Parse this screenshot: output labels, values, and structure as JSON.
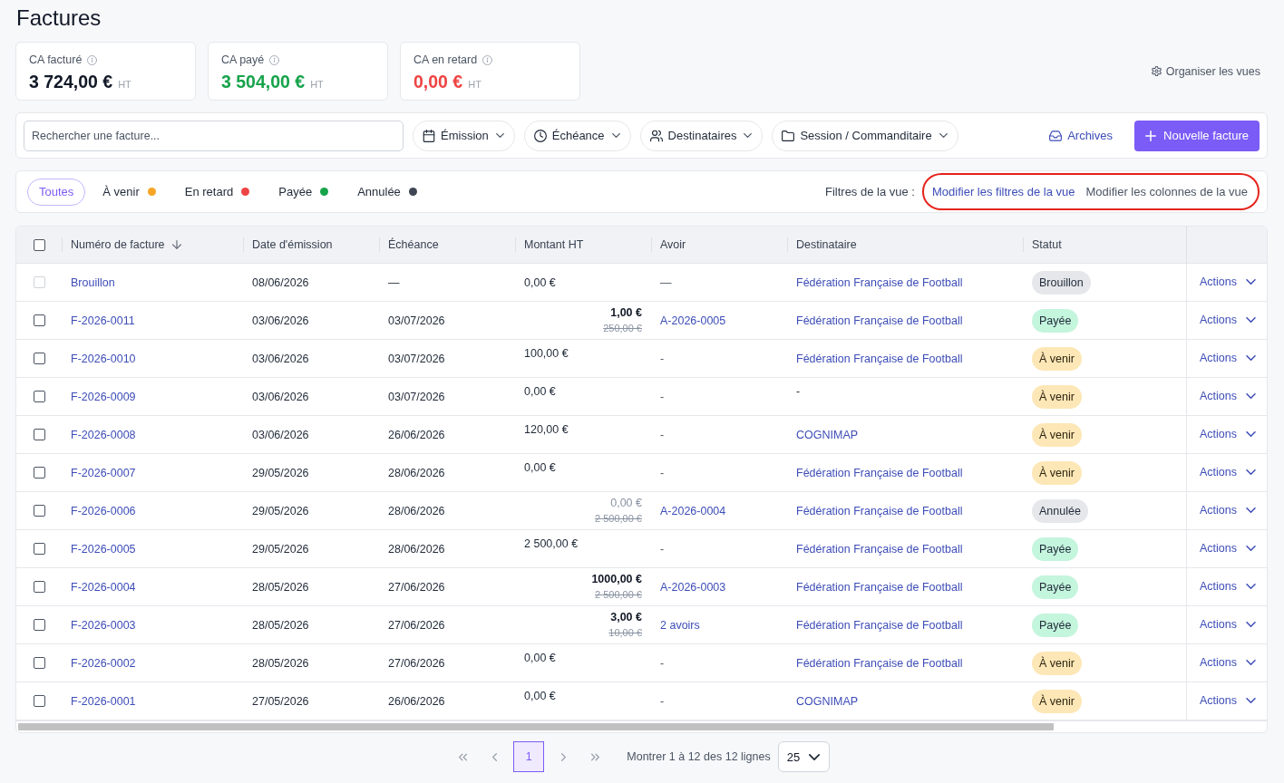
{
  "page": {
    "title": "Factures"
  },
  "kpis": [
    {
      "label": "CA facturé",
      "value": "3 724,00 €",
      "unit": "HT",
      "color": "#111827"
    },
    {
      "label": "CA payé",
      "value": "3 504,00 €",
      "unit": "HT",
      "color": "#16a34a"
    },
    {
      "label": "CA en retard",
      "value": "0,00 €",
      "unit": "HT",
      "color": "#ef4444"
    }
  ],
  "organize_views": {
    "label": "Organiser les vues"
  },
  "toolbar": {
    "search": {
      "placeholder": "Rechercher une facture..."
    },
    "filters": [
      {
        "label": "Émission",
        "kind": "calendar"
      },
      {
        "label": "Échéance",
        "kind": "clock"
      },
      {
        "label": "Destinataires",
        "kind": "people"
      },
      {
        "label": "Session / Commanditaire",
        "kind": "folder"
      }
    ],
    "archives": {
      "label": "Archives"
    },
    "new_button": {
      "label": "Nouvelle facture"
    }
  },
  "status_tabs": [
    {
      "label": "Toutes",
      "selected": true
    },
    {
      "label": "À venir",
      "selected": false,
      "color": "#f5a524"
    },
    {
      "label": "En retard",
      "selected": false,
      "color": "#ef4444"
    },
    {
      "label": "Payée",
      "selected": false,
      "color": "#16a34a"
    },
    {
      "label": "Annulée",
      "selected": false,
      "color": "#3f4654"
    }
  ],
  "view_filters": {
    "label": "Filtres de la vue :",
    "circled": true,
    "links": [
      {
        "label": "Modifier les filtres de la vue",
        "kind": "primary"
      },
      {
        "label": "Modifier les colonnes de la vue",
        "kind": "secondary"
      }
    ]
  },
  "table": {
    "select_all": {
      "checked": false
    },
    "columns": [
      {
        "label": "Numéro de facture",
        "sorted": true
      },
      {
        "label": "Date d'émission",
        "sorted": false
      },
      {
        "label": "Échéance",
        "sorted": false
      },
      {
        "label": "Montant HT",
        "sorted": false
      },
      {
        "label": "Avoir",
        "sorted": false
      },
      {
        "label": "Destinataire",
        "sorted": false
      },
      {
        "label": "Statut",
        "sorted": false
      }
    ],
    "rows": [
      {
        "checkbox": {
          "checked": false,
          "disabled": true
        },
        "number": "Brouillon",
        "issue_date": "08/06/2026",
        "due_date": "—",
        "amount": {
          "kind": "draft",
          "value": "0,00 €"
        },
        "credit_note": {
          "text": "—",
          "link": false
        },
        "recipient": {
          "text": "Fédération Française de Football",
          "link": true
        },
        "status": {
          "label": "Brouillon",
          "kind": "draft"
        },
        "actions": "Actions"
      },
      {
        "checkbox": {
          "checked": false,
          "disabled": false
        },
        "number": "F-2026-0011",
        "issue_date": "03/06/2026",
        "due_date": "03/07/2026",
        "amount": {
          "kind": "credited",
          "value": "1,00 €",
          "original": "250,00 €"
        },
        "credit_note": {
          "text": "A-2026-0005",
          "link": true
        },
        "recipient": {
          "text": "Fédération Française de Football",
          "link": true
        },
        "status": {
          "label": "Payée",
          "kind": "paid"
        },
        "actions": "Actions"
      },
      {
        "checkbox": {
          "checked": false,
          "disabled": false
        },
        "number": "F-2026-0010",
        "issue_date": "03/06/2026",
        "due_date": "03/07/2026",
        "amount": {
          "kind": "plain",
          "value": "100,00 €"
        },
        "credit_note": {
          "text": "-",
          "link": false
        },
        "recipient": {
          "text": "Fédération Française de Football",
          "link": true
        },
        "status": {
          "label": "À venir",
          "kind": "upcoming"
        },
        "actions": "Actions"
      },
      {
        "checkbox": {
          "checked": false,
          "disabled": false
        },
        "number": "F-2026-0009",
        "issue_date": "03/06/2026",
        "due_date": "03/07/2026",
        "amount": {
          "kind": "plain",
          "value": "0,00 €"
        },
        "credit_note": {
          "text": "-",
          "link": false
        },
        "recipient": {
          "text": "-",
          "link": false
        },
        "status": {
          "label": "À venir",
          "kind": "upcoming"
        },
        "actions": "Actions"
      },
      {
        "checkbox": {
          "checked": false,
          "disabled": false
        },
        "number": "F-2026-0008",
        "issue_date": "03/06/2026",
        "due_date": "26/06/2026",
        "amount": {
          "kind": "plain",
          "value": "120,00 €"
        },
        "credit_note": {
          "text": "-",
          "link": false
        },
        "recipient": {
          "text": "COGNIMAP",
          "link": true
        },
        "status": {
          "label": "À venir",
          "kind": "upcoming"
        },
        "actions": "Actions"
      },
      {
        "checkbox": {
          "checked": false,
          "disabled": false
        },
        "number": "F-2026-0007",
        "issue_date": "29/05/2026",
        "due_date": "28/06/2026",
        "amount": {
          "kind": "plain",
          "value": "0,00 €"
        },
        "credit_note": {
          "text": "-",
          "link": false
        },
        "recipient": {
          "text": "Fédération Française de Football",
          "link": true
        },
        "status": {
          "label": "À venir",
          "kind": "upcoming"
        },
        "actions": "Actions"
      },
      {
        "checkbox": {
          "checked": false,
          "disabled": false
        },
        "number": "F-2026-0006",
        "issue_date": "29/05/2026",
        "due_date": "28/06/2026",
        "amount": {
          "kind": "cancelled",
          "value": "0,00 €",
          "original": "2 500,00 €"
        },
        "credit_note": {
          "text": "A-2026-0004",
          "link": true
        },
        "recipient": {
          "text": "Fédération Française de Football",
          "link": true
        },
        "status": {
          "label": "Annulée",
          "kind": "cancelled"
        },
        "actions": "Actions"
      },
      {
        "checkbox": {
          "checked": false,
          "disabled": false
        },
        "number": "F-2026-0005",
        "issue_date": "29/05/2026",
        "due_date": "28/06/2026",
        "amount": {
          "kind": "plain",
          "value": "2 500,00 €"
        },
        "credit_note": {
          "text": "-",
          "link": false
        },
        "recipient": {
          "text": "Fédération Française de Football",
          "link": true
        },
        "status": {
          "label": "Payée",
          "kind": "paid"
        },
        "actions": "Actions"
      },
      {
        "checkbox": {
          "checked": false,
          "disabled": false
        },
        "number": "F-2026-0004",
        "issue_date": "28/05/2026",
        "due_date": "27/06/2026",
        "amount": {
          "kind": "credited",
          "value": "1000,00 €",
          "original": "2 500,00 €"
        },
        "credit_note": {
          "text": "A-2026-0003",
          "link": true
        },
        "recipient": {
          "text": "Fédération Française de Football",
          "link": true
        },
        "status": {
          "label": "Payée",
          "kind": "paid"
        },
        "actions": "Actions"
      },
      {
        "checkbox": {
          "checked": false,
          "disabled": false
        },
        "number": "F-2026-0003",
        "issue_date": "28/05/2026",
        "due_date": "27/06/2026",
        "amount": {
          "kind": "credited",
          "value": "3,00 €",
          "original": "10,00 €"
        },
        "credit_note": {
          "text": "2 avoirs",
          "link": true
        },
        "recipient": {
          "text": "Fédération Française de Football",
          "link": true
        },
        "status": {
          "label": "Payée",
          "kind": "paid"
        },
        "actions": "Actions"
      },
      {
        "checkbox": {
          "checked": false,
          "disabled": false
        },
        "number": "F-2026-0002",
        "issue_date": "28/05/2026",
        "due_date": "27/06/2026",
        "amount": {
          "kind": "plain",
          "value": "0,00 €"
        },
        "credit_note": {
          "text": "-",
          "link": false
        },
        "recipient": {
          "text": "Fédération Française de Football",
          "link": true
        },
        "status": {
          "label": "À venir",
          "kind": "upcoming"
        },
        "actions": "Actions"
      },
      {
        "checkbox": {
          "checked": false,
          "disabled": false
        },
        "number": "F-2026-0001",
        "issue_date": "27/05/2026",
        "due_date": "26/06/2026",
        "amount": {
          "kind": "plain",
          "value": "0,00 €"
        },
        "credit_note": {
          "text": "-",
          "link": false
        },
        "recipient": {
          "text": "COGNIMAP",
          "link": true
        },
        "status": {
          "label": "À venir",
          "kind": "upcoming"
        },
        "actions": "Actions"
      }
    ]
  },
  "pagination": {
    "nav": [
      {
        "kind": "first",
        "disabled": true
      },
      {
        "kind": "previous",
        "disabled": true
      },
      {
        "kind": "next",
        "disabled": true
      },
      {
        "kind": "last",
        "disabled": true
      }
    ],
    "pages": [
      {
        "label": "1",
        "selected": true
      }
    ],
    "summary": "Montrer 1 à 12 des 12 lignes",
    "page_size": "25"
  }
}
